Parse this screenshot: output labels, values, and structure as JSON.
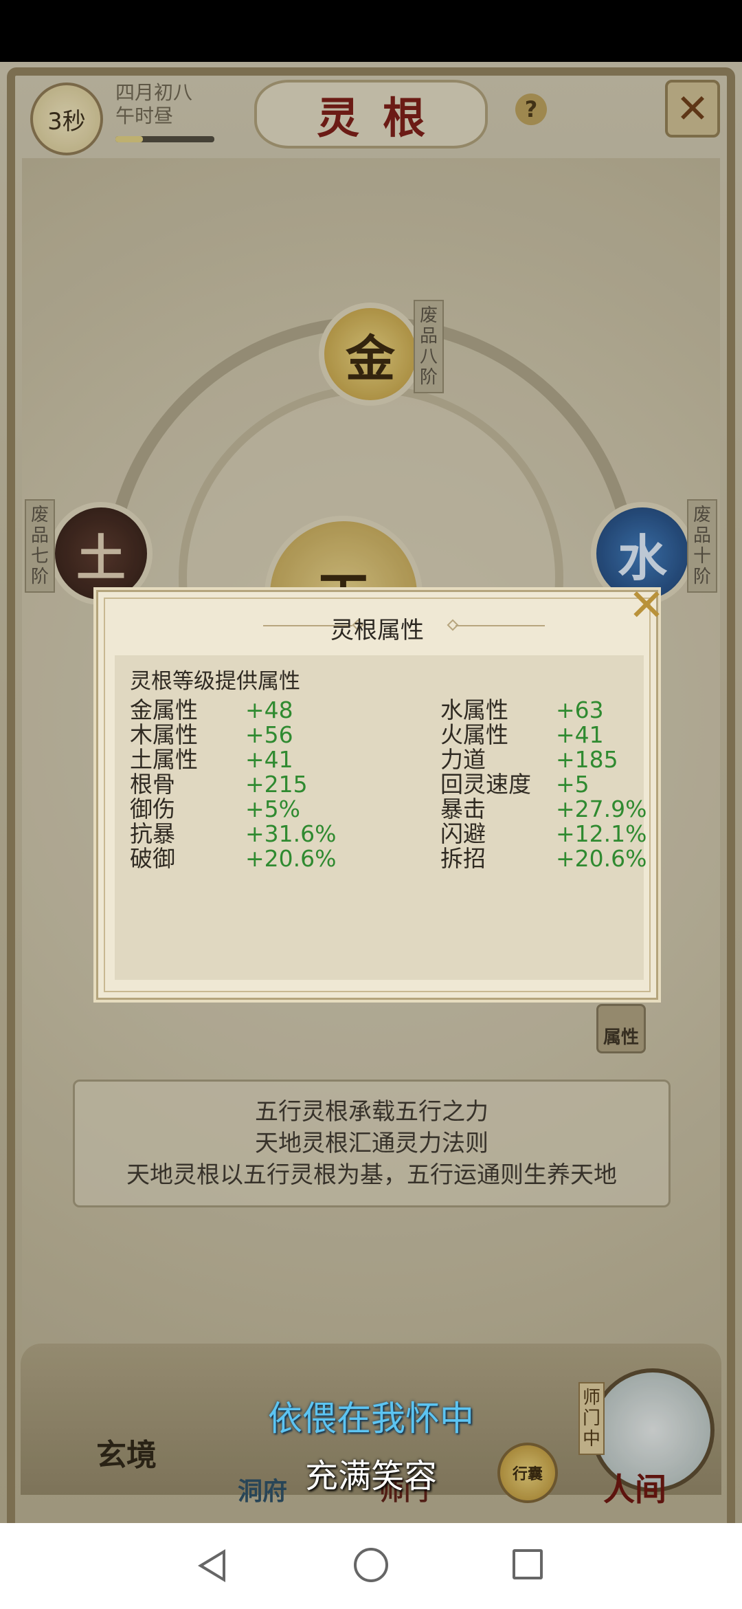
{
  "header": {
    "timer": "3秒",
    "date_line1": "四月初八",
    "date_line2": "午时昼",
    "title": "灵根"
  },
  "elements": {
    "metal": "金",
    "earth": "土",
    "water": "水",
    "heaven": "天"
  },
  "ranks": {
    "metal": "废品八阶",
    "earth": "废品七阶",
    "water": "废品十阶"
  },
  "attr_button": "属性",
  "modal": {
    "title": "灵根属性",
    "heading": "灵根等级提供属性",
    "stats_left": [
      {
        "label": "金属性",
        "value": "+48"
      },
      {
        "label": "木属性",
        "value": "+56"
      },
      {
        "label": "土属性",
        "value": "+41"
      },
      {
        "label": "根骨",
        "value": "+215"
      },
      {
        "label": "御伤",
        "value": "+5%"
      },
      {
        "label": "抗暴",
        "value": "+31.6%"
      },
      {
        "label": "破御",
        "value": "+20.6%"
      }
    ],
    "stats_right": [
      {
        "label": "水属性",
        "value": "+63"
      },
      {
        "label": "火属性",
        "value": "+41"
      },
      {
        "label": "力道",
        "value": "+185"
      },
      {
        "label": "回灵速度",
        "value": "+5"
      },
      {
        "label": "暴击",
        "value": "+27.9%"
      },
      {
        "label": "闪避",
        "value": "+12.1%"
      },
      {
        "label": "拆招",
        "value": "+20.6%"
      }
    ]
  },
  "info": [
    "五行灵根承载五行之力",
    "天地灵根汇通灵力法则",
    "天地灵根以五行灵根为基，五行运通则生养天地"
  ],
  "nav": {
    "xuanjing": "玄境",
    "dongfu": "洞府",
    "shimen": "师门",
    "xingnang": "行囊",
    "renjian": "人间",
    "shimen_tag": "师门中"
  },
  "subtitles": {
    "line1": "依偎在我怀中",
    "line2": "充满笑容"
  }
}
